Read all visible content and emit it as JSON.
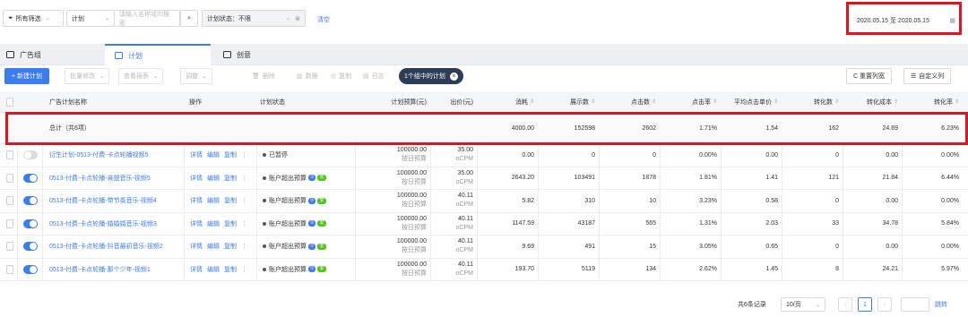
{
  "filters": {
    "all_filter": "所有筛选",
    "plan_select": "计划",
    "search_placeholder": "请输入名称或ID搜索",
    "status_select": "计划状态：不限",
    "reset": "清空",
    "date_range": "2020.05.15 至 2020.05.15"
  },
  "tabs": [
    {
      "label": "广告组"
    },
    {
      "label": "计划"
    },
    {
      "label": "创意"
    }
  ],
  "toolbar": {
    "new_plan": "+ 新建计划",
    "bulk_edit": "批量修改",
    "view_report": "查看报表",
    "other": "调整",
    "delete": "删除",
    "data": "数据",
    "copy": "复制",
    "log": "日志",
    "selected_pill": "1个组中的计划",
    "reorder": "C 重置列宽",
    "custom_cols": "自定义列"
  },
  "columns": {
    "name": "广告计划名称",
    "ops": "操作",
    "status": "计划状态",
    "budget": "计划预算(元)",
    "bid": "出价(元)",
    "cost": "消耗",
    "impressions": "展示数",
    "clicks": "点击数",
    "ctr": "点击率",
    "cpc": "平均点击单价",
    "conversions": "转化数",
    "cpa": "转化成本",
    "cvr": "转化率"
  },
  "total": {
    "label": "总计（共6项）",
    "cost": "4000.00",
    "impressions": "152598",
    "clicks": "2602",
    "ctr": "1.71%",
    "cpc": "1.54",
    "conversions": "162",
    "cpa": "24.69",
    "cvr": "6.23%"
  },
  "ops_labels": {
    "detail": "详情",
    "edit": "编辑",
    "copy": "复制",
    "more": "⋮"
  },
  "rows": [
    {
      "name": "衍生计划-0513-付费-卡点轮播视频5",
      "status": "已暂停",
      "budget": "100000.00",
      "budget_type": "按日预算",
      "bid": "35.00",
      "bid_type": "oCPM",
      "cost": "0.00",
      "impressions": "0",
      "clicks": "0",
      "ctr": "0.00%",
      "cpc": "0.00",
      "conversions": "0",
      "cpa": "0.00",
      "cvr": "0.00%"
    },
    {
      "name": "0513-付费-卡点轮播-亲提音乐-视频5",
      "status": "账户超出预算",
      "budget": "100000.00",
      "budget_type": "按日预算",
      "bid": "35.00",
      "bid_type": "oCPM",
      "cost": "2643.20",
      "impressions": "103491",
      "clicks": "1878",
      "ctr": "1.81%",
      "cpc": "1.41",
      "conversions": "121",
      "cpa": "21.84",
      "cvr": "6.44%"
    },
    {
      "name": "0513-付费-卡点轮播-带节奏音乐-视频4",
      "status": "账户超出预算",
      "budget": "100000.00",
      "budget_type": "按日预算",
      "bid": "40.11",
      "bid_type": "oCPM",
      "cost": "5.82",
      "impressions": "310",
      "clicks": "10",
      "ctr": "3.23%",
      "cpc": "0.58",
      "conversions": "0",
      "cpa": "0.00",
      "cvr": "0.00%"
    },
    {
      "name": "0513-付费-卡点轮播-婚婚婚音乐-视频3",
      "status": "账户超出预算",
      "budget": "100000.00",
      "budget_type": "按日预算",
      "bid": "40.11",
      "bid_type": "oCPM",
      "cost": "1147.59",
      "impressions": "43187",
      "clicks": "565",
      "ctr": "1.31%",
      "cpc": "2.03",
      "conversions": "33",
      "cpa": "34.78",
      "cvr": "5.84%"
    },
    {
      "name": "0513-付费-卡点轮播-抖音最初音乐-视频2",
      "status": "账户超出预算",
      "budget": "100000.00",
      "budget_type": "按日预算",
      "bid": "40.11",
      "bid_type": "oCPM",
      "cost": "9.69",
      "impressions": "491",
      "clicks": "15",
      "ctr": "3.05%",
      "cpc": "0.65",
      "conversions": "0",
      "cpa": "0.00",
      "cvr": "0.00%"
    },
    {
      "name": "0513-付费-卡点轮播-那个少年-视频1",
      "status": "账户超出预算",
      "budget": "100000.00",
      "budget_type": "按日预算",
      "bid": "40.11",
      "bid_type": "oCPM",
      "cost": "193.70",
      "impressions": "5119",
      "clicks": "134",
      "ctr": "2.62%",
      "cpc": "1.45",
      "conversions": "8",
      "cpa": "24.21",
      "cvr": "5.97%"
    }
  ],
  "status_badges": {
    "a": "①",
    "b": "安"
  },
  "pager": {
    "total": "共6条记录",
    "page_size": "10/页",
    "current": "1",
    "goto": "跳转"
  },
  "colors": {
    "accent": "#3b7cf0",
    "highlight": "#e0141e"
  }
}
